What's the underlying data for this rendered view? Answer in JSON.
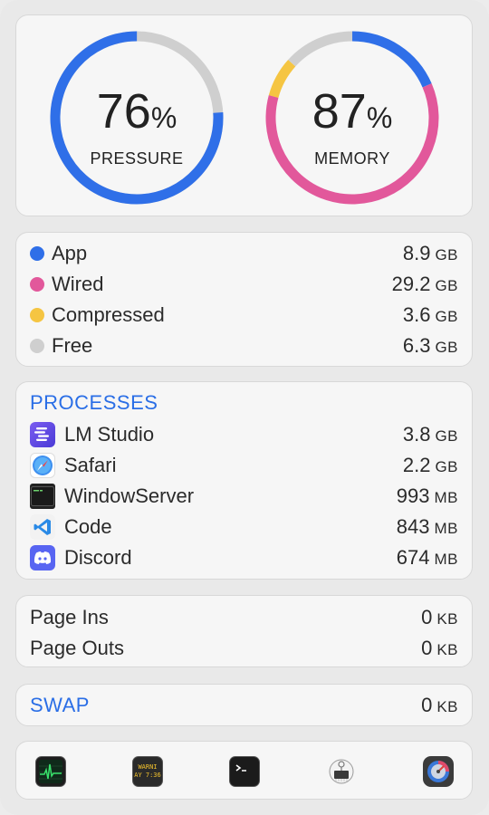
{
  "gauges": {
    "pressure": {
      "value": "76",
      "unit": "%",
      "label": "PRESSURE",
      "fraction": 0.76,
      "color": "#2f6fe8",
      "track": "#cfcfcf"
    },
    "memory": {
      "value": "87",
      "unit": "%",
      "label": "MEMORY",
      "segments": [
        {
          "name": "App",
          "fraction": 0.185,
          "color": "#2f6fe8"
        },
        {
          "name": "Wired",
          "fraction": 0.607,
          "color": "#e2589b"
        },
        {
          "name": "Compressed",
          "fraction": 0.075,
          "color": "#f5c542"
        },
        {
          "name": "Free",
          "fraction": 0.133,
          "color": "#cfcfcf"
        }
      ]
    }
  },
  "legend": [
    {
      "label": "App",
      "value": "8.9",
      "unit": "GB",
      "color": "#2f6fe8"
    },
    {
      "label": "Wired",
      "value": "29.2",
      "unit": "GB",
      "color": "#e2589b"
    },
    {
      "label": "Compressed",
      "value": "3.6",
      "unit": "GB",
      "color": "#f5c542"
    },
    {
      "label": "Free",
      "value": "6.3",
      "unit": "GB",
      "color": "#cfcfcf"
    }
  ],
  "processes": {
    "title": "PROCESSES",
    "items": [
      {
        "name": "LM Studio",
        "value": "3.8",
        "unit": "GB",
        "icon": "lm-studio-icon"
      },
      {
        "name": "Safari",
        "value": "2.2",
        "unit": "GB",
        "icon": "safari-icon"
      },
      {
        "name": "WindowServer",
        "value": "993",
        "unit": "MB",
        "icon": "terminal-window-icon"
      },
      {
        "name": "Code",
        "value": "843",
        "unit": "MB",
        "icon": "vscode-icon"
      },
      {
        "name": "Discord",
        "value": "674",
        "unit": "MB",
        "icon": "discord-icon"
      }
    ]
  },
  "paging": [
    {
      "label": "Page Ins",
      "value": "0",
      "unit": "KB"
    },
    {
      "label": "Page Outs",
      "value": "0",
      "unit": "KB"
    }
  ],
  "swap": {
    "label": "SWAP",
    "value": "0",
    "unit": "KB"
  },
  "dock": [
    {
      "icon": "activity-monitor-icon"
    },
    {
      "icon": "console-icon",
      "text1": "WARNI",
      "text2": "AY 7:36"
    },
    {
      "icon": "terminal-icon"
    },
    {
      "icon": "system-information-icon"
    },
    {
      "icon": "disk-utility-icon"
    }
  ]
}
